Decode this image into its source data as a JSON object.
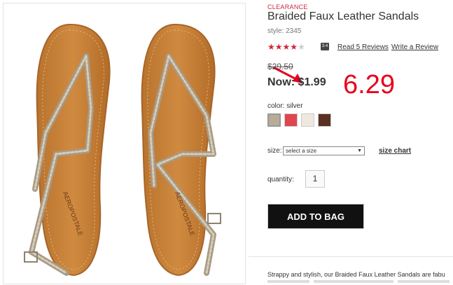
{
  "product": {
    "badge": "CLEARANCE",
    "title": "Braided Faux Leather Sandals",
    "style": "style: 2345",
    "rating": 3.5,
    "rating_badge": "3.4",
    "reviews_link": "Read 5 Reviews",
    "write_review_link": "Write a Review",
    "was_price": "$29.50",
    "now_price": "Now: $1.99",
    "annotation": "6.29",
    "color_label": "color: silver",
    "swatches": [
      "silver",
      "coral",
      "white",
      "brown"
    ],
    "swatch_colors": [
      "#b9ab94",
      "#e0464f",
      "#efe8de",
      "#5a3022"
    ],
    "size_label": "size:",
    "size_placeholder": "select a size",
    "size_chart_link": "size chart",
    "quantity_label": "quantity:",
    "quantity_value": "1",
    "add_to_bag": "ADD TO BAG",
    "description": "Strappy and stylish, our Braided Faux Leather Sandals are fabu"
  },
  "image": {
    "brand_text": "AEROPOSTALE"
  },
  "colors": {
    "accent": "#d0263a",
    "annotation": "#e8001c",
    "button": "#111111"
  }
}
